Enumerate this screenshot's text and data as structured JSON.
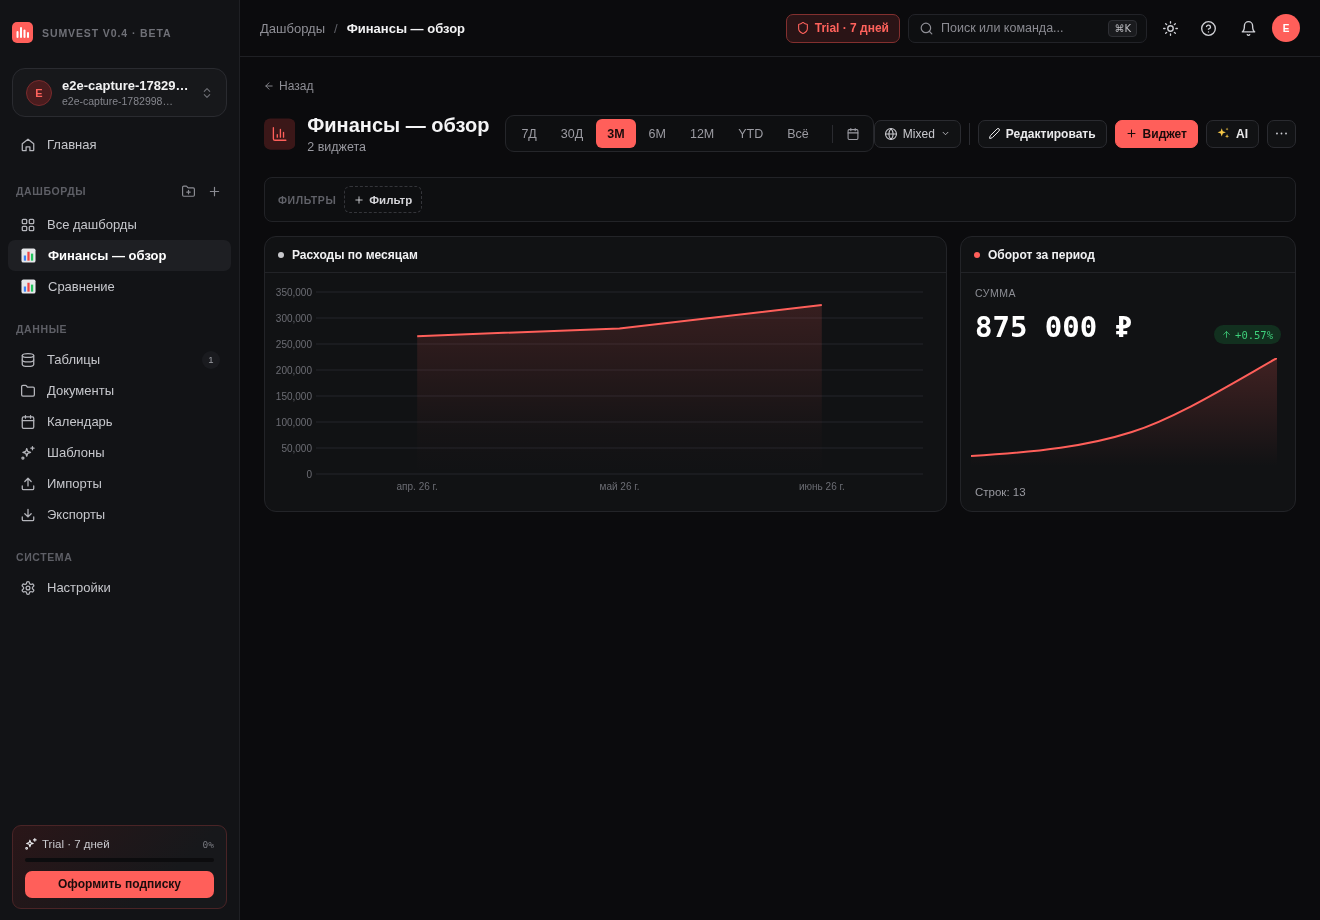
{
  "sidebar": {
    "brand": "SUMVEST V0.4 · BETA",
    "workspace": {
      "avatar": "E",
      "name": "e2e-capture-17829…",
      "id": "e2e-capture-1782998…"
    },
    "sections": [
      {
        "kind": "main",
        "items": [
          {
            "label": "Главная",
            "selected": false
          }
        ]
      },
      {
        "kind": "dashboards",
        "title": "ДАШБОРДЫ",
        "items": [
          {
            "label": "Все дашборды",
            "selected": false
          },
          {
            "label": "Финансы — обзор",
            "selected": true
          },
          {
            "label": "Сравнение",
            "selected": false
          }
        ]
      },
      {
        "kind": "data",
        "title": "ДАННЫЕ",
        "items": [
          {
            "label": "Таблицы",
            "selected": false,
            "count": "1"
          },
          {
            "label": "Документы",
            "selected": false
          },
          {
            "label": "Календарь",
            "selected": false
          },
          {
            "label": "Шаблоны",
            "selected": false
          },
          {
            "label": "Импорты",
            "selected": false
          },
          {
            "label": "Экспорты",
            "selected": false
          }
        ]
      },
      {
        "kind": "system",
        "title": "СИСТЕМА",
        "items": [
          {
            "label": "Настройки",
            "selected": false
          }
        ]
      }
    ],
    "trial": {
      "label": "Trial · 7 дней",
      "percent": "0%",
      "button": "Оформить подписку"
    }
  },
  "topbar": {
    "breadcrumb": [
      {
        "label": "Дашборды",
        "selected": false
      },
      {
        "label": "Финансы — обзор",
        "selected": true
      }
    ],
    "separator": "/",
    "trial_badge": "Trial · 7 дней",
    "search": {
      "placeholder": "Поиск или команда...",
      "shortcut": "⌘K"
    },
    "avatar": "E"
  },
  "header": {
    "back": "Назад",
    "title": "Финансы — обзор",
    "subtitle": "2 виджета",
    "periods": [
      {
        "label": "7Д",
        "selected": false
      },
      {
        "label": "30Д",
        "selected": false
      },
      {
        "label": "3М",
        "selected": true
      },
      {
        "label": "6М",
        "selected": false
      },
      {
        "label": "12М",
        "selected": false
      },
      {
        "label": "YTD",
        "selected": false
      },
      {
        "label": "Всё",
        "selected": false
      }
    ],
    "mode": "Mixed",
    "buttons": {
      "edit": "Редактировать",
      "add": "Виджет",
      "ai": "AI"
    }
  },
  "filters": {
    "label": "ФИЛЬТРЫ",
    "add": "Фильтр"
  },
  "widgets": [
    {
      "kind": "chart",
      "title": "Расходы по месяцам",
      "color": "#c8c8cc",
      "chart_data": {
        "type": "area",
        "categories": [
          "апр. 26 г.",
          "май 26 г.",
          "июнь 26 г."
        ],
        "series": [
          {
            "color": "#ff5f5a",
            "values": [
              265000,
              280000,
              325000
            ]
          }
        ],
        "ylim": [
          0,
          350000
        ],
        "yticks": [
          {
            "value": 0,
            "label": "0"
          },
          {
            "value": 50000,
            "label": "50,000"
          },
          {
            "value": 100000,
            "label": "100,000"
          },
          {
            "value": 150000,
            "label": "150,000"
          },
          {
            "value": 200000,
            "label": "200,000"
          },
          {
            "value": 250000,
            "label": "250,000"
          },
          {
            "value": 300000,
            "label": "300,000"
          },
          {
            "value": 350000,
            "label": "350,000"
          }
        ],
        "grid": true
      }
    },
    {
      "kind": "kpi",
      "title": "Оборот за период",
      "color": "#ff5f5a",
      "label": "СУММА",
      "value": "875 000 ₽",
      "change": "+0.57%",
      "footer": "Строк: 13"
    }
  ]
}
